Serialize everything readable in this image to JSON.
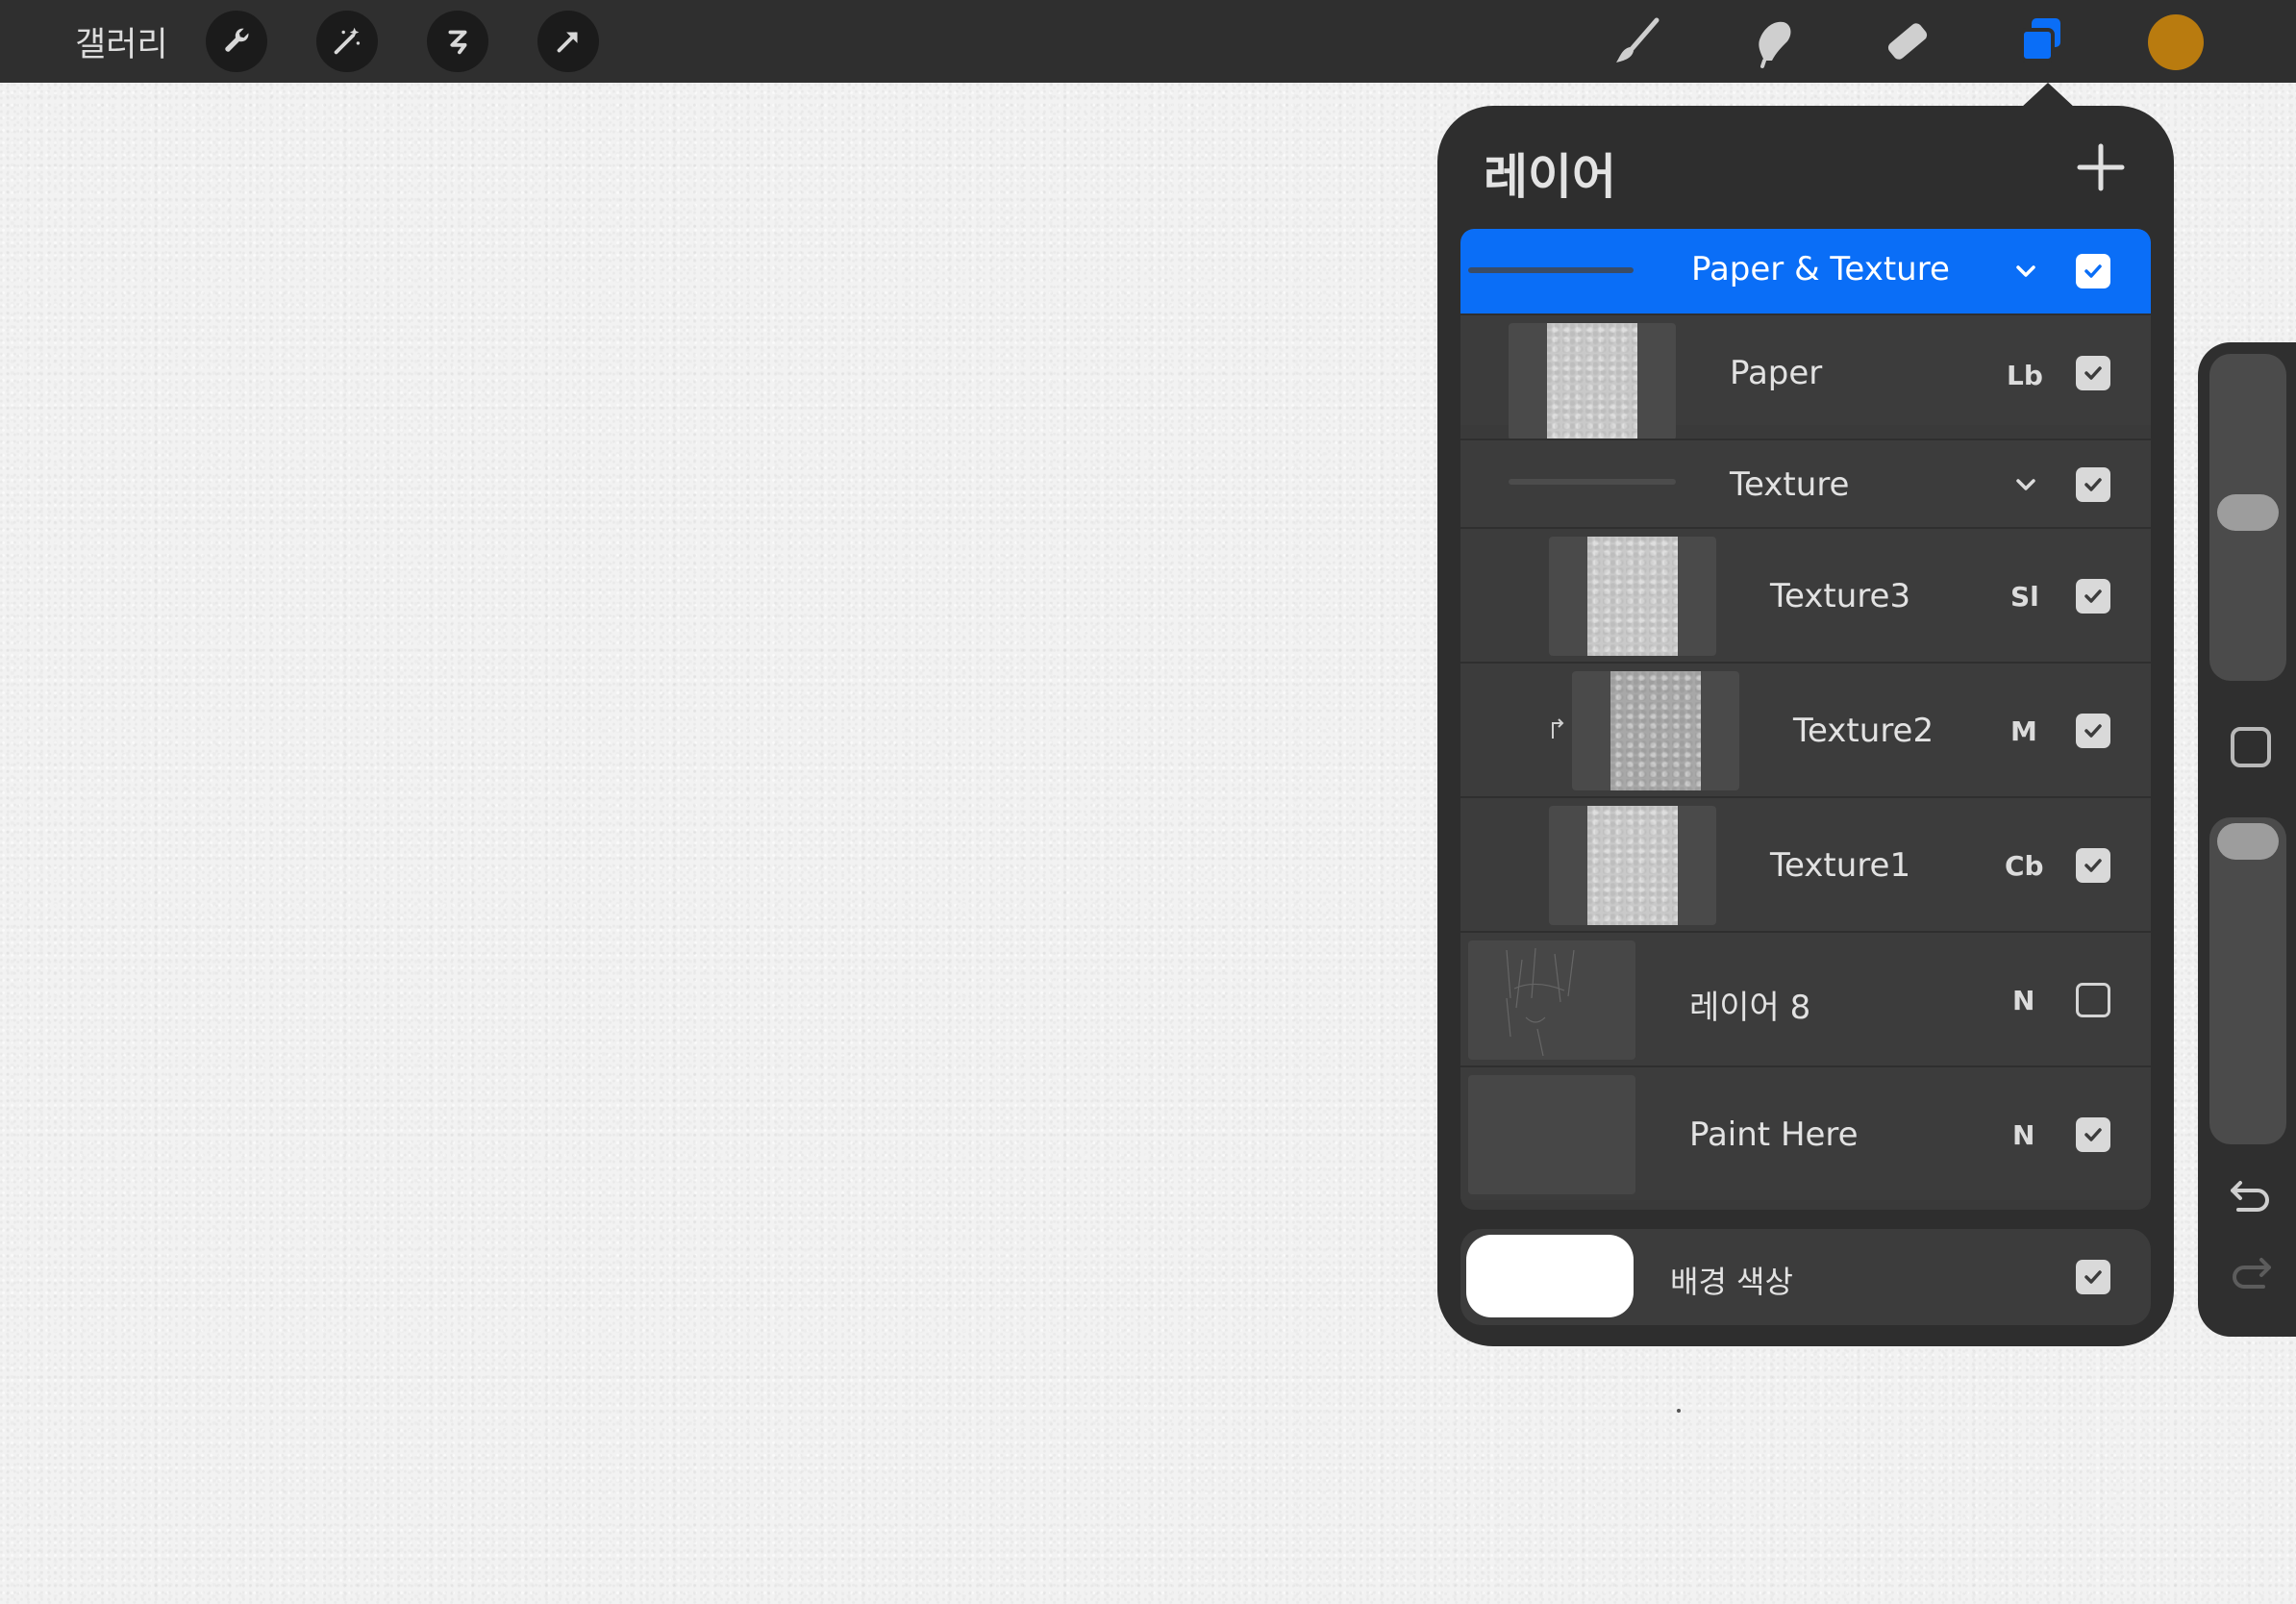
{
  "toolbar": {
    "gallery_label": "갤러리",
    "left_tools": [
      "wrench-icon",
      "magic-wand-icon",
      "selection-icon",
      "transform-icon"
    ],
    "right_tools": [
      "brush-icon",
      "smudge-icon",
      "eraser-icon",
      "layers-icon"
    ],
    "active_tool": "layers-icon",
    "current_color": "#b97b0f"
  },
  "layers_panel": {
    "title": "레이어",
    "add_label": "+",
    "layers": [
      {
        "name": "Paper & Texture",
        "type": "group",
        "blend": "",
        "visible": true,
        "selected": true
      },
      {
        "name": "Paper",
        "type": "layer",
        "blend": "Lb",
        "visible": true
      },
      {
        "name": "Texture",
        "type": "group",
        "blend": "",
        "visible": true
      },
      {
        "name": "Texture3",
        "type": "layer",
        "blend": "Sl",
        "visible": true
      },
      {
        "name": "Texture2",
        "type": "layer",
        "blend": "M",
        "visible": true,
        "clipping_mask": true
      },
      {
        "name": "Texture1",
        "type": "layer",
        "blend": "Cb",
        "visible": true
      },
      {
        "name": "레이어 8",
        "type": "layer",
        "blend": "N",
        "visible": false
      },
      {
        "name": "Paint Here",
        "type": "layer",
        "blend": "N",
        "visible": true
      }
    ],
    "background": {
      "label": "배경 색상",
      "color": "#ffffff",
      "visible": true
    }
  },
  "colors": {
    "accent": "#0a6ef7",
    "panel": "#2e2e2e",
    "toolbar": "#2f2f2f"
  }
}
